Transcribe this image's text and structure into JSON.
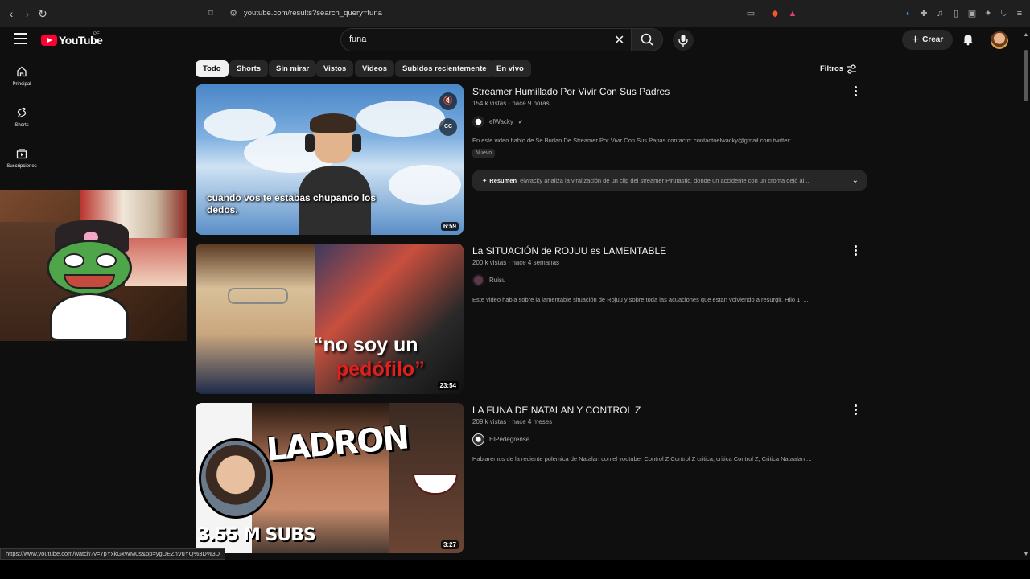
{
  "browser": {
    "url": "youtube.com/results?search_query=funa"
  },
  "header": {
    "logo_text": "YouTube",
    "logo_country": "PE",
    "search_value": "funa",
    "create_label": "Crear"
  },
  "sidebar": {
    "items": [
      {
        "label": "Principal",
        "icon": "home-icon"
      },
      {
        "label": "Shorts",
        "icon": "shorts-icon"
      },
      {
        "label": "Suscripciones",
        "icon": "subscriptions-icon"
      }
    ]
  },
  "chips": [
    "Todo",
    "Shorts",
    "Sin mirar",
    "Vistos",
    "Videos",
    "Subidos recientemente",
    "En vivo"
  ],
  "filters_label": "Filtros",
  "results": [
    {
      "title": "Streamer Humillado Por Vivir Con Sus Padres",
      "meta": "154 k vistas · hace 9 horas",
      "channel": "elWacky",
      "description": "En este video hablo de Se Burlan De Streamer Por Vivir Con Sus Papás contacto: contactoelwacky@gmail.com twitter: ...",
      "badge": "Nuevo",
      "duration": "6:59",
      "thumb_caption": "cuando vos te estabas chupando los dedos.",
      "summary_label": "Resumen",
      "summary_text": "elWacky analiza la viralización de un clip del streamer Pirutastic, donde un accidente con un croma dejó al..."
    },
    {
      "title": "La SITUACIÓN de ROJUU es LAMENTABLE",
      "meta": "200 k vistas · hace 4 semanas",
      "channel": "Ruisu",
      "description": "Este video habla sobre la lamentable situación de Rojuu y sobre toda las acuaciones que estan volviendo a resurgir. Hilo 1: ...",
      "duration": "23:54",
      "thumb_text1": "“no soy un",
      "thumb_text2": "pedófilo”"
    },
    {
      "title": "LA FUNA DE NATALAN Y CONTROL Z",
      "meta": "209 k vistas · hace 4 meses",
      "channel": "ElPedegrense",
      "description": "Hablaremos de la reciente polemica de Natalan con el youtuber Control Z Control Z critica, critica Control Z, Critica Nataalan ...",
      "duration": "3:27",
      "thumb_title": "LADRON",
      "thumb_subs": "3.55 M SUBS"
    }
  ],
  "status_url": "https://www.youtube.com/watch?v=7pYxkGxWM0s&pp=ygUEZnVuYQ%3D%3D",
  "colors": {
    "background": "#0f0f0f",
    "brand": "#ff0033",
    "chip_active": "#f1f1f1"
  }
}
